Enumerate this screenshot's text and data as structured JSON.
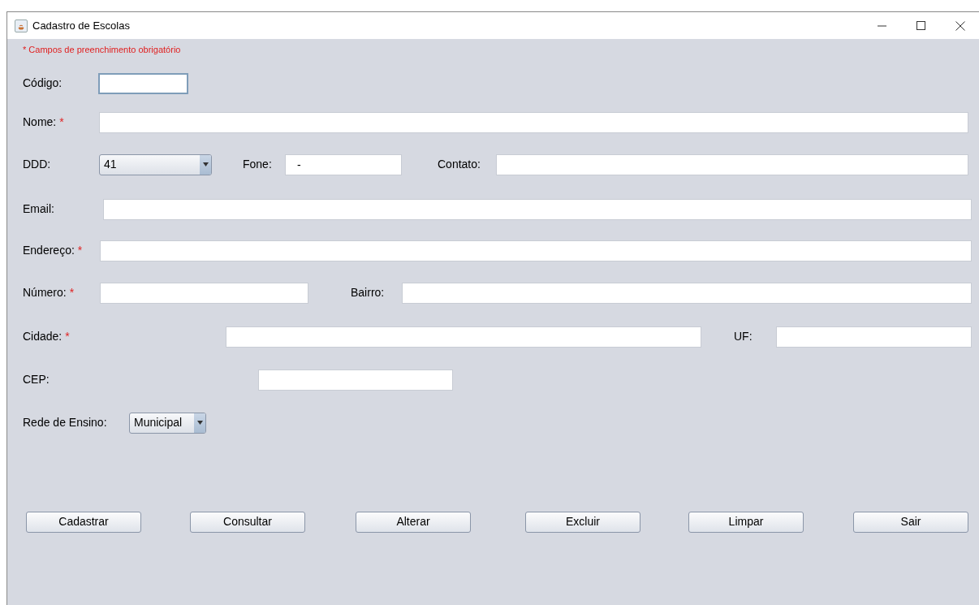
{
  "window": {
    "title": "Cadastro de Escolas"
  },
  "note": "* Campos de preenchimento obrigatório",
  "rows": [
    {
      "items": [
        {
          "kind": "label",
          "text": "Código:"
        },
        {
          "kind": "field",
          "value": "",
          "focused": true
        }
      ]
    },
    {
      "items": [
        {
          "kind": "label",
          "text": "Nome:",
          "marker": "*"
        },
        {
          "kind": "field",
          "value": "",
          "focused": false
        }
      ]
    },
    {
      "items": [
        {
          "kind": "label",
          "text": "DDD:"
        },
        {
          "kind": "combo",
          "value": "41"
        },
        {
          "kind": "label",
          "text": "Fone:"
        },
        {
          "kind": "field",
          "value": "-",
          "focused": false
        },
        {
          "kind": "label",
          "text": "Contato:"
        },
        {
          "kind": "field",
          "value": "",
          "focused": false
        }
      ]
    },
    {
      "items": [
        {
          "kind": "label",
          "text": "Email:"
        },
        {
          "kind": "field",
          "value": "",
          "focused": false
        }
      ]
    },
    {
      "items": [
        {
          "kind": "label",
          "text": "Endereço:",
          "marker": "*"
        },
        {
          "kind": "field",
          "value": "",
          "focused": false
        }
      ]
    },
    {
      "items": [
        {
          "kind": "label",
          "text": "Número:",
          "marker": "*"
        },
        {
          "kind": "field",
          "value": "",
          "focused": false
        },
        {
          "kind": "label",
          "text": "Bairro:"
        },
        {
          "kind": "field",
          "value": "",
          "focused": false
        }
      ]
    },
    {
      "items": [
        {
          "kind": "label",
          "text": "Cidade:",
          "marker": "*"
        },
        {
          "kind": "field",
          "value": "",
          "focused": false
        },
        {
          "kind": "label",
          "text": "UF:"
        },
        {
          "kind": "field",
          "value": "",
          "focused": false
        }
      ]
    },
    {
      "items": [
        {
          "kind": "label",
          "text": "CEP:"
        },
        {
          "kind": "field",
          "value": "",
          "focused": false
        }
      ]
    },
    {
      "items": [
        {
          "kind": "label",
          "text": "Rede de Ensino:"
        },
        {
          "kind": "combo",
          "value": "Municipal"
        }
      ]
    }
  ],
  "buttons": [
    "Cadastrar",
    "Consultar",
    "Alterar",
    "Excluir",
    "Limpar",
    "Sair"
  ]
}
